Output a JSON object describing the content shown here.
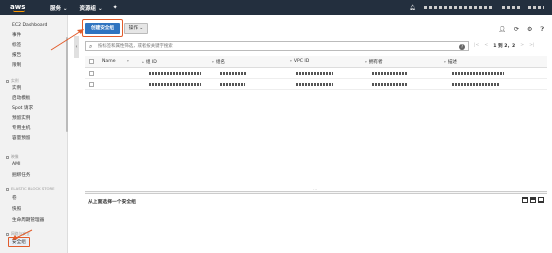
{
  "topbar": {
    "logo": "aws",
    "services": "服务",
    "resource_groups": "资源组",
    "bell_icon": "bell-icon",
    "pin_icon": "pin-icon"
  },
  "sidebar": {
    "items": [
      {
        "label": "EC2 Dashboard"
      },
      {
        "label": "事件"
      },
      {
        "label": "标签"
      },
      {
        "label": "报告"
      },
      {
        "label": "限制"
      }
    ],
    "instances_section": "实例",
    "instances_items": [
      "实例",
      "启动模板",
      "Spot 请求",
      "预留实例",
      "专用主机",
      "容量预留"
    ],
    "images_section": "映像",
    "images_items": [
      "AMI",
      "捆绑任务"
    ],
    "ebs_section": "ELASTIC BLOCK STORE",
    "ebs_items": [
      "卷",
      "快照",
      "生命周期管理器"
    ],
    "network_section": "网络与安全",
    "network_items": [
      "安全组"
    ]
  },
  "toolbar": {
    "create_label": "创建安全组",
    "actions_label": "操作"
  },
  "search": {
    "placeholder": "按标签和属性筛选，或者按关键字搜索"
  },
  "pager": {
    "range": "1 到 2，2"
  },
  "table": {
    "columns": [
      "Name",
      "组 ID",
      "组名",
      "VPC ID",
      "拥有者",
      "描述"
    ]
  },
  "details": {
    "title": "从上面选择一个安全组"
  },
  "colors": {
    "topbar_bg": "#232f3e",
    "primary_button": "#2f74c0",
    "annotation": "#e25c2b"
  }
}
